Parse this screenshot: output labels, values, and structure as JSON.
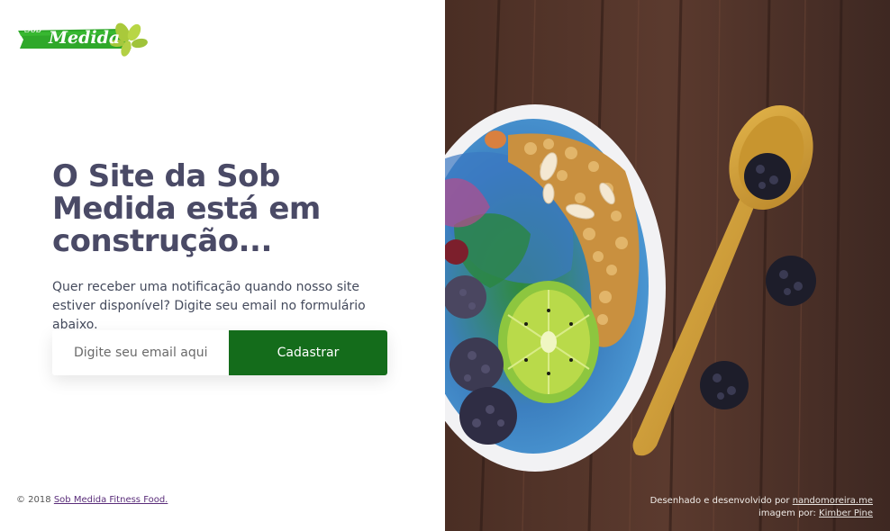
{
  "logo": {
    "small_text": "Sob",
    "main_text": "Medida"
  },
  "hero": {
    "headline": "O Site da Sob Medida está em construção...",
    "description": "Quer receber uma notificação quando nosso site estiver disponível? Digite seu email no formulário abaixo."
  },
  "form": {
    "email_placeholder": "Digite seu email aqui",
    "submit_label": "Cadastrar"
  },
  "footer": {
    "copyright": "© 2018",
    "company_link": "Sob Medida Fitness Food."
  },
  "credits": {
    "designed_prefix": "Desenhado e desenvolvido por",
    "designer_link": "nandomoreira.me",
    "image_prefix": "imagem por:",
    "photographer_link": "Kimber Pine"
  },
  "colors": {
    "accent": "#146c1b",
    "heading": "#4a4a66",
    "logo_green": "#2fa82a"
  }
}
